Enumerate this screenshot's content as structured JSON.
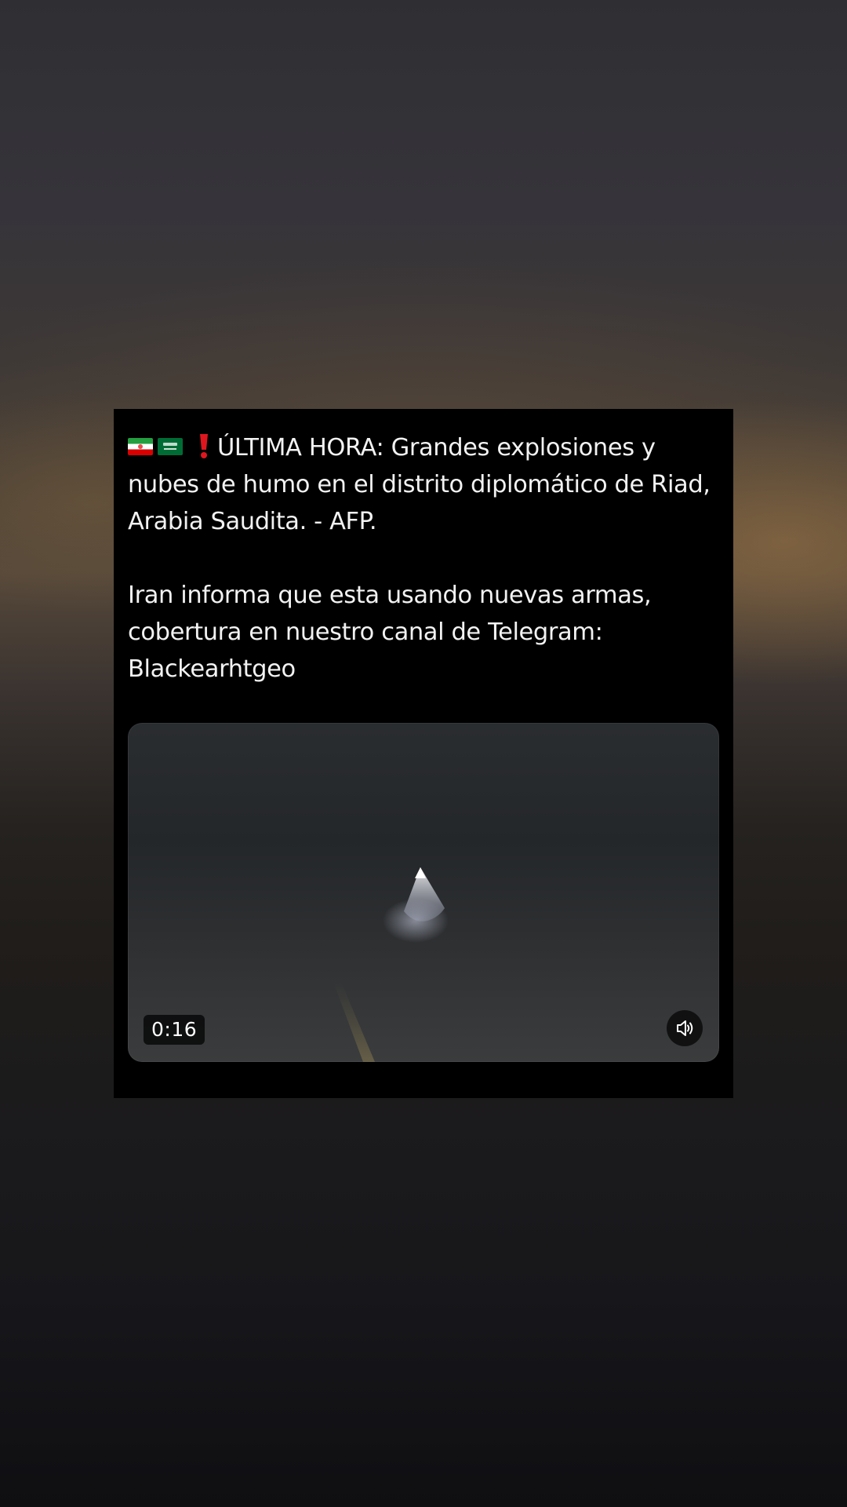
{
  "post": {
    "flags": [
      "iran-flag-icon",
      "saudi-arabia-flag-icon",
      "red-exclamation-icon"
    ],
    "headline": "ÚLTIMA HORA: Grandes explosiones y nubes de humo en el distrito diplomático de Riad, Arabia Saudita. - AFP.",
    "body": "Iran informa que esta usando nuevas armas, cobertura en nuestro canal de Telegram: Blackearhtgeo"
  },
  "video": {
    "duration": "0:16",
    "volume_icon": "speaker-volume-icon"
  },
  "colors": {
    "card_background": "#000000",
    "text": "#f2f2f2",
    "exclamation": "#e0161e"
  }
}
